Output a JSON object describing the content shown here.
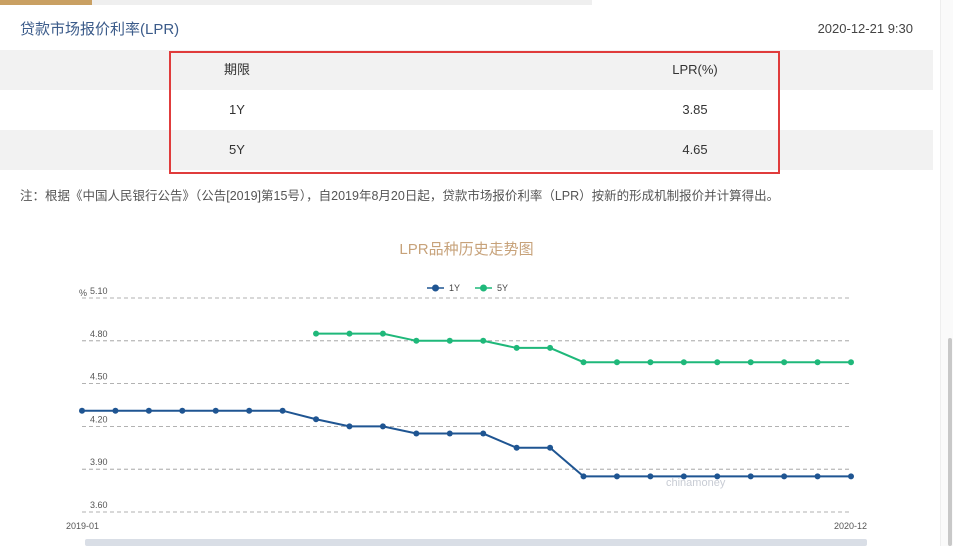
{
  "header": {
    "title": "贷款市场报价利率(LPR)",
    "timestamp": "2020-12-21 9:30"
  },
  "table": {
    "headers": [
      "期限",
      "LPR(%)"
    ],
    "rows": [
      {
        "term": "1Y",
        "rate": "3.85"
      },
      {
        "term": "5Y",
        "rate": "4.65"
      }
    ]
  },
  "note": "注：根据《中国人民银行公告》（公告[2019]第15号），自2019年8月20日起，贷款市场报价利率（LPR）按新的形成机制报价并计算得出。",
  "chart_data": {
    "type": "line",
    "title": "LPR品种历史走势图",
    "ylabel": "%",
    "ylim": [
      3.6,
      5.1
    ],
    "yticks": [
      "5.10",
      "4.80",
      "4.50",
      "4.20",
      "3.90",
      "3.60"
    ],
    "xtick_labels": [
      "2019-01",
      "2020-12"
    ],
    "watermark": "chinamoney",
    "legend_position": "top-center",
    "grid": true,
    "x": [
      "2019-01",
      "2019-02",
      "2019-03",
      "2019-04",
      "2019-05",
      "2019-06",
      "2019-07",
      "2019-08",
      "2019-09",
      "2019-10",
      "2019-11",
      "2019-12",
      "2020-01",
      "2020-02",
      "2020-03",
      "2020-04",
      "2020-05",
      "2020-06",
      "2020-07",
      "2020-08",
      "2020-09",
      "2020-10",
      "2020-11",
      "2020-12"
    ],
    "series": [
      {
        "name": "1Y",
        "color": "#1f5592",
        "values": [
          4.31,
          4.31,
          4.31,
          4.31,
          4.31,
          4.31,
          4.31,
          4.25,
          4.2,
          4.2,
          4.15,
          4.15,
          4.15,
          4.05,
          4.05,
          3.85,
          3.85,
          3.85,
          3.85,
          3.85,
          3.85,
          3.85,
          3.85,
          3.85
        ]
      },
      {
        "name": "5Y",
        "color": "#1fb87a",
        "values": [
          null,
          null,
          null,
          null,
          null,
          null,
          null,
          4.85,
          4.85,
          4.85,
          4.8,
          4.8,
          4.8,
          4.75,
          4.75,
          4.65,
          4.65,
          4.65,
          4.65,
          4.65,
          4.65,
          4.65,
          4.65,
          4.65
        ]
      }
    ]
  }
}
